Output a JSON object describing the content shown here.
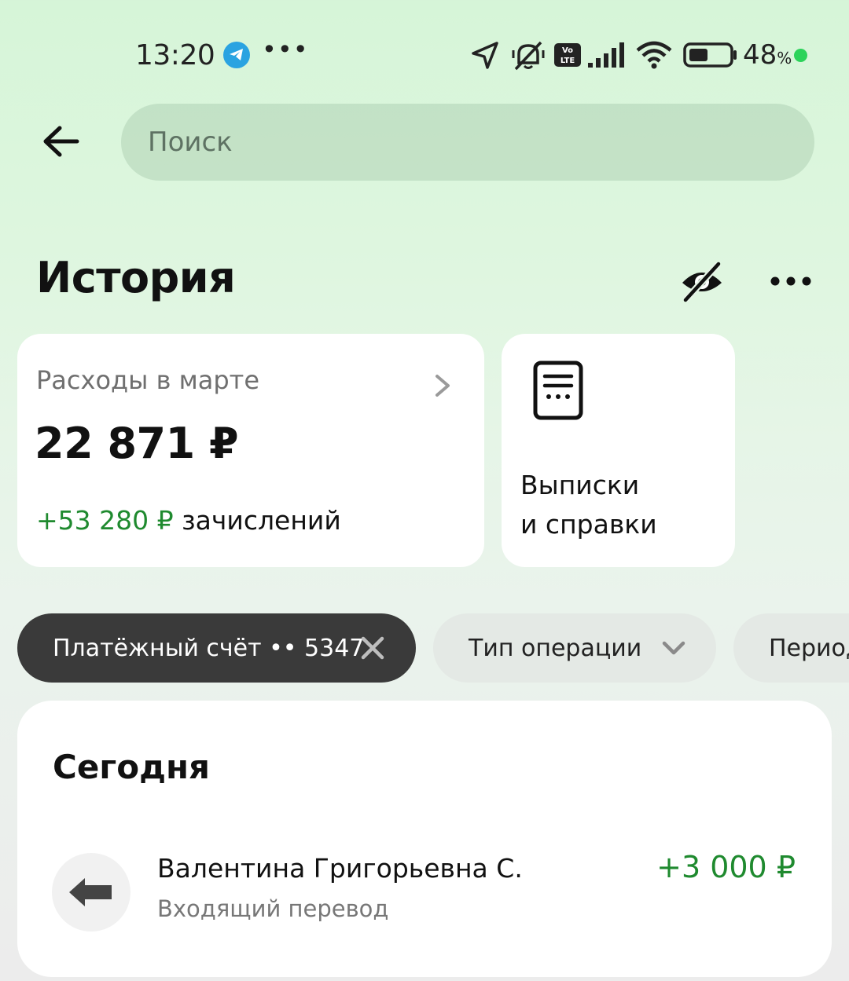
{
  "status_bar": {
    "time": "13:20",
    "more": "•••",
    "battery_percent": "48",
    "battery_unit": "%",
    "battery_level": 0.48,
    "icons": [
      "telegram-icon",
      "location-arrow-icon",
      "bell-muted-icon",
      "volte-icon",
      "signal-icon",
      "wifi-icon",
      "battery-icon"
    ]
  },
  "search": {
    "placeholder": "Поиск"
  },
  "header": {
    "title": "История"
  },
  "expenses_card": {
    "label": "Расходы в марте",
    "amount": "22 871 ₽",
    "income_amount": "+53 280 ₽",
    "income_label": " зачислений"
  },
  "docs_card": {
    "line1": "Выписки",
    "line2": "и справки"
  },
  "filters": {
    "account": "Платёжный счёт •• 5347",
    "operation_type": "Тип операции",
    "period": "Период"
  },
  "operations": {
    "section_title": "Сегодня",
    "items": [
      {
        "name": "Валентина Григорьевна С.",
        "type": "Входящий перевод",
        "amount": "+3 000 ₽"
      }
    ]
  },
  "colors": {
    "accent_green": "#1f8a2f",
    "chip_dark": "#3a3a3a",
    "status_dot": "#2cd35a",
    "telegram": "#2aa3e1"
  }
}
